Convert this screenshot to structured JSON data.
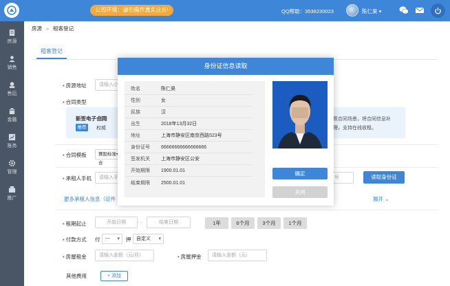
{
  "header": {
    "notice": "公司环境：请勿操作真实业务!",
    "qq_help": "QQ帮助：3536230023",
    "user_name": "陈仁昊 ▾"
  },
  "sidebar": {
    "items": [
      {
        "label": "房源",
        "icon": "building-icon"
      },
      {
        "label": "销售",
        "icon": "users-icon"
      },
      {
        "label": "售后",
        "icon": "service-icon"
      },
      {
        "label": "金融",
        "icon": "bank-icon"
      },
      {
        "label": "账务",
        "icon": "chart-icon"
      },
      {
        "label": "管理",
        "icon": "gear-icon"
      },
      {
        "label": "推广",
        "icon": "promotion-icon"
      }
    ]
  },
  "breadcrumb": {
    "root": "房源",
    "sep": "»",
    "current": "租客登记"
  },
  "tab": {
    "label": "租客登记"
  },
  "form": {
    "address_label": "房源地址",
    "address_placeholder": "请输入小区",
    "contract_type_label": "合同类型",
    "contract_title": "新签电子合同",
    "contract_desc1": "适用",
    "contract_desc2": "权威",
    "contract_recommend": "推荐",
    "contract_right1": "质合同场景，将合同信息补",
    "contract_right2": "理，支持在线收租。",
    "template_label": "合同模板",
    "template_value": "赛励标准合",
    "phone_label": "承租人手机",
    "phone_placeholder": "请输入手",
    "phone_right_placeholder": "号",
    "read_id_button": "读取身份证",
    "more_renters": "更多承租人信息（证件",
    "expand": "展开",
    "rent_period_label": "租期起止",
    "start_date": "开始日期",
    "date_sep": "-",
    "end_date": "结束日期",
    "period_buttons": [
      "1年",
      "6个月",
      "3个月",
      "1个月"
    ],
    "payment_label": "付款方式",
    "pay": "付",
    "pay_value": "---",
    "deposit": "押",
    "deposit_value": "自定义",
    "rent_label": "房屋租金",
    "rent_placeholder": "请输入金额（元/月）",
    "deposit_label": "房屋押金",
    "deposit_placeholder": "请输入金额（元）",
    "other_fees_label": "其他费用",
    "add_button": "+ 添加"
  },
  "modal": {
    "title": "身份证信息读取",
    "rows": [
      {
        "k": "姓名",
        "v": "陈仁昊"
      },
      {
        "k": "性别",
        "v": "女"
      },
      {
        "k": "民族",
        "v": "汉"
      },
      {
        "k": "出生",
        "v": "2018年13月32日"
      },
      {
        "k": "地址",
        "v": "上海市静安区南京西路523号"
      },
      {
        "k": "身份证号",
        "v": "66666666666666666"
      },
      {
        "k": "签发机关",
        "v": "上海市静安区公安"
      },
      {
        "k": "开始期限",
        "v": "1900.01.01"
      },
      {
        "k": "结束期限",
        "v": "2500.01.01"
      }
    ],
    "confirm": "确定",
    "close": "关闭"
  },
  "colors": {
    "primary": "#3d86d8",
    "sidebar": "#4a5566",
    "notice": "#f5a93b"
  }
}
